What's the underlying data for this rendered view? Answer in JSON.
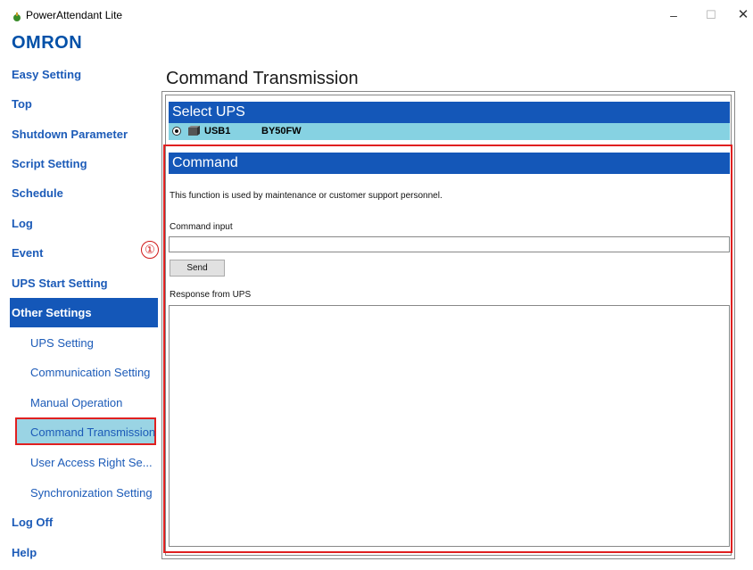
{
  "window": {
    "title": "PowerAttendant Lite",
    "minimize": "–",
    "maximize": "☐",
    "close": "✕"
  },
  "logo": "omron",
  "sidebar": {
    "items": [
      {
        "label": "Easy Setting"
      },
      {
        "label": "Top"
      },
      {
        "label": "Shutdown Parameter"
      },
      {
        "label": "Script Setting"
      },
      {
        "label": "Schedule"
      },
      {
        "label": "Log"
      },
      {
        "label": "Event"
      },
      {
        "label": "UPS Start Setting"
      },
      {
        "label": "Other Settings"
      },
      {
        "label": "UPS Setting"
      },
      {
        "label": "Communication Setting"
      },
      {
        "label": "Manual Operation"
      },
      {
        "label": "Command Transmission"
      },
      {
        "label": "User Access Right Se..."
      },
      {
        "label": "Synchronization Setting"
      },
      {
        "label": "Log Off"
      },
      {
        "label": "Help"
      }
    ],
    "active_section": "Other Settings",
    "selected_item": "Command Transmission",
    "marker": "①"
  },
  "main": {
    "title": "Command Transmission",
    "select_ups": {
      "header": "Select UPS",
      "row": {
        "port": "USB1",
        "model": "BY50FW"
      }
    },
    "command": {
      "header": "Command",
      "description": "This function is used by maintenance or customer support personnel.",
      "input_label": "Command input",
      "input_value": "",
      "send_label": "Send",
      "response_label": "Response from UPS",
      "response_value": ""
    }
  },
  "colors": {
    "header_blue": "#1457b8",
    "ups_row": "#86d2e2",
    "selected_bg": "#9ad4e4",
    "highlight_red": "#e02020",
    "nav_text": "#1c5bb8"
  }
}
